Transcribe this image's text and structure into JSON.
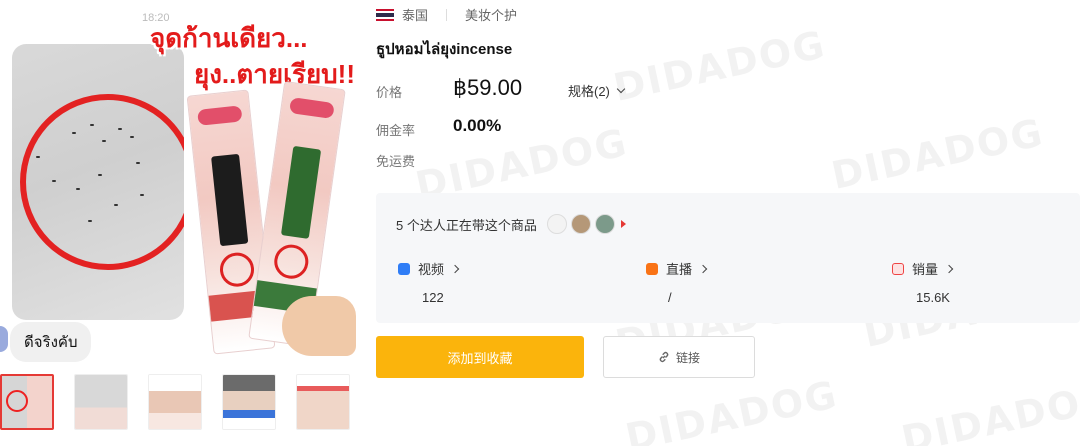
{
  "watermark": "DIDADOG",
  "main_image": {
    "status_time": "18:20",
    "overlay_line1": "จุดก้านเดียว...",
    "overlay_line2": "ยุง..ตายเรียบ!!",
    "chat_text": "ดีจริงคับ"
  },
  "meta": {
    "country": "泰国",
    "category": "美妆个护"
  },
  "product": {
    "title": "ธูปหอมไล่ยุงincense",
    "price_label": "价格",
    "price": "฿59.00",
    "spec_label": "规格(2)",
    "commission_label": "佣金率",
    "commission": "0.00%",
    "shipping_label": "免运费"
  },
  "creators": {
    "text": "5 个达人正在带这个商品"
  },
  "stats": [
    {
      "label": "视频",
      "value": "122",
      "icon": "video-icon",
      "color": "#2f7df6"
    },
    {
      "label": "直播",
      "value": "/",
      "icon": "live-icon",
      "color": "#f97316"
    },
    {
      "label": "销量",
      "value": "15.6K",
      "icon": "sales-icon",
      "color": "#ef4444"
    }
  ],
  "actions": {
    "favorite": "添加到收藏",
    "link": "链接"
  },
  "colors": {
    "accent": "#fbb40c",
    "thumb_active": "#e53935"
  }
}
